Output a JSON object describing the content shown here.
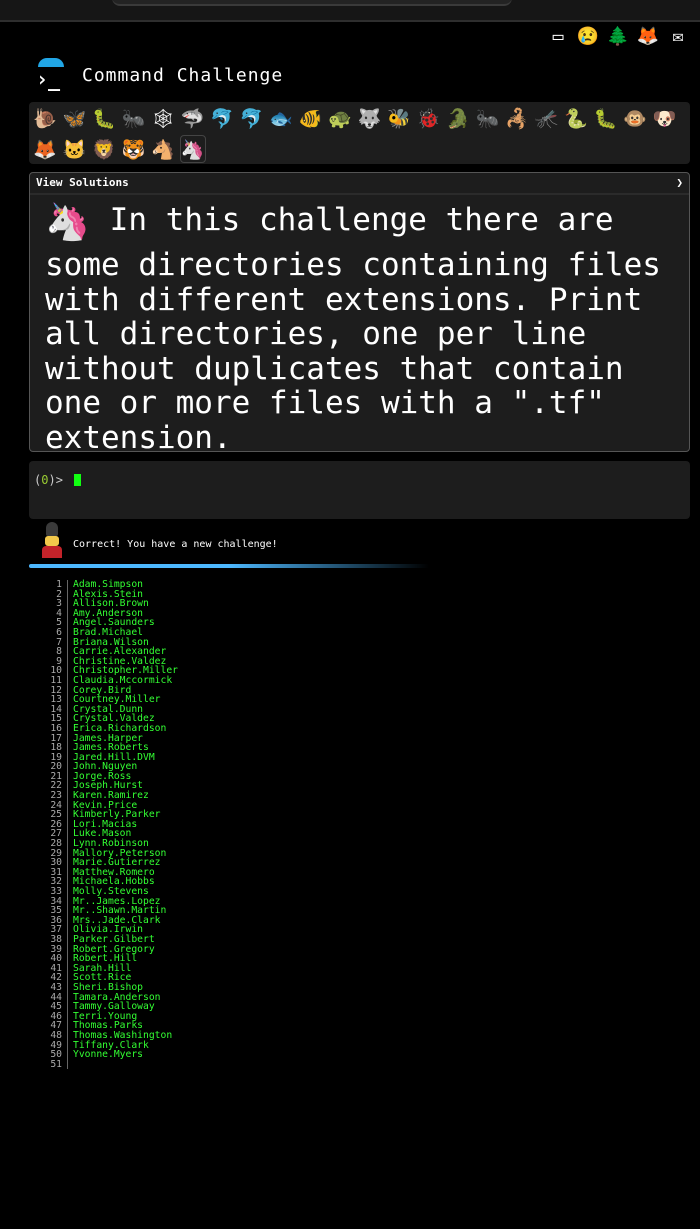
{
  "topbar": {
    "nav_icons": [
      {
        "name": "cmdchallenge-icon",
        "glyph": "▭"
      },
      {
        "name": "crying-face-icon",
        "glyph": "😢"
      },
      {
        "name": "tree-icon",
        "glyph": "🌲"
      },
      {
        "name": "gitlab-icon",
        "glyph": "🦊"
      },
      {
        "name": "mail-icon",
        "glyph": "✉"
      }
    ]
  },
  "brand": {
    "title": "Command Challenge",
    "logo_glyph": "›_"
  },
  "levels": {
    "row1": [
      "🐌",
      "🦋",
      "🐛",
      "🐜",
      "🕸",
      "🦈",
      "🐬",
      "🐬",
      "🐟",
      "🐠",
      "🐢",
      "🐺",
      "🐝",
      "🐞",
      "🐊",
      "🐜",
      "🦂",
      "🦟",
      "🐍",
      "🐛",
      "🐵",
      "🐶"
    ],
    "row2": [
      "🦊",
      "🐱",
      "🦁",
      "🐯",
      "🐴",
      "🦄"
    ]
  },
  "challenge": {
    "view_solutions": "View Solutions",
    "chevron": "❯",
    "unicorn_glyph": "🦄",
    "description": "In this challenge there are some directories containing files with different extensions. Print all directories, one per line without duplicates that contain one or more files with a \".tf\" extension."
  },
  "terminal": {
    "prompt_open": "(",
    "exit_code": "0",
    "prompt_close": ")> "
  },
  "status": {
    "message": "Correct! You have a new challenge!"
  },
  "output": {
    "lines": [
      "Adam.Simpson",
      "Alexis.Stein",
      "Allison.Brown",
      "Amy.Anderson",
      "Angel.Saunders",
      "Brad.Michael",
      "Briana.Wilson",
      "Carrie.Alexander",
      "Christine.Valdez",
      "Christopher.Miller",
      "Claudia.Mccormick",
      "Corey.Bird",
      "Courtney.Miller",
      "Crystal.Dunn",
      "Crystal.Valdez",
      "Erica.Richardson",
      "James.Harper",
      "James.Roberts",
      "Jared.Hill.DVM",
      "John.Nguyen",
      "Jorge.Ross",
      "Joseph.Hurst",
      "Karen.Ramirez",
      "Kevin.Price",
      "Kimberly.Parker",
      "Lori.Macias",
      "Luke.Mason",
      "Lynn.Robinson",
      "Mallory.Peterson",
      "Marie.Gutierrez",
      "Matthew.Romero",
      "Michaela.Hobbs",
      "Molly.Stevens",
      "Mr..James.Lopez",
      "Mr..Shawn.Martin",
      "Mrs..Jade.Clark",
      "Olivia.Irwin",
      "Parker.Gilbert",
      "Robert.Gregory",
      "Robert.Hill",
      "Sarah.Hill",
      "Scott.Rice",
      "Sheri.Bishop",
      "Tamara.Anderson",
      "Tammy.Galloway",
      "Terri.Young",
      "Thomas.Parks",
      "Thomas.Washington",
      "Tiffany.Clark",
      "Yvonne.Myers",
      ""
    ]
  }
}
